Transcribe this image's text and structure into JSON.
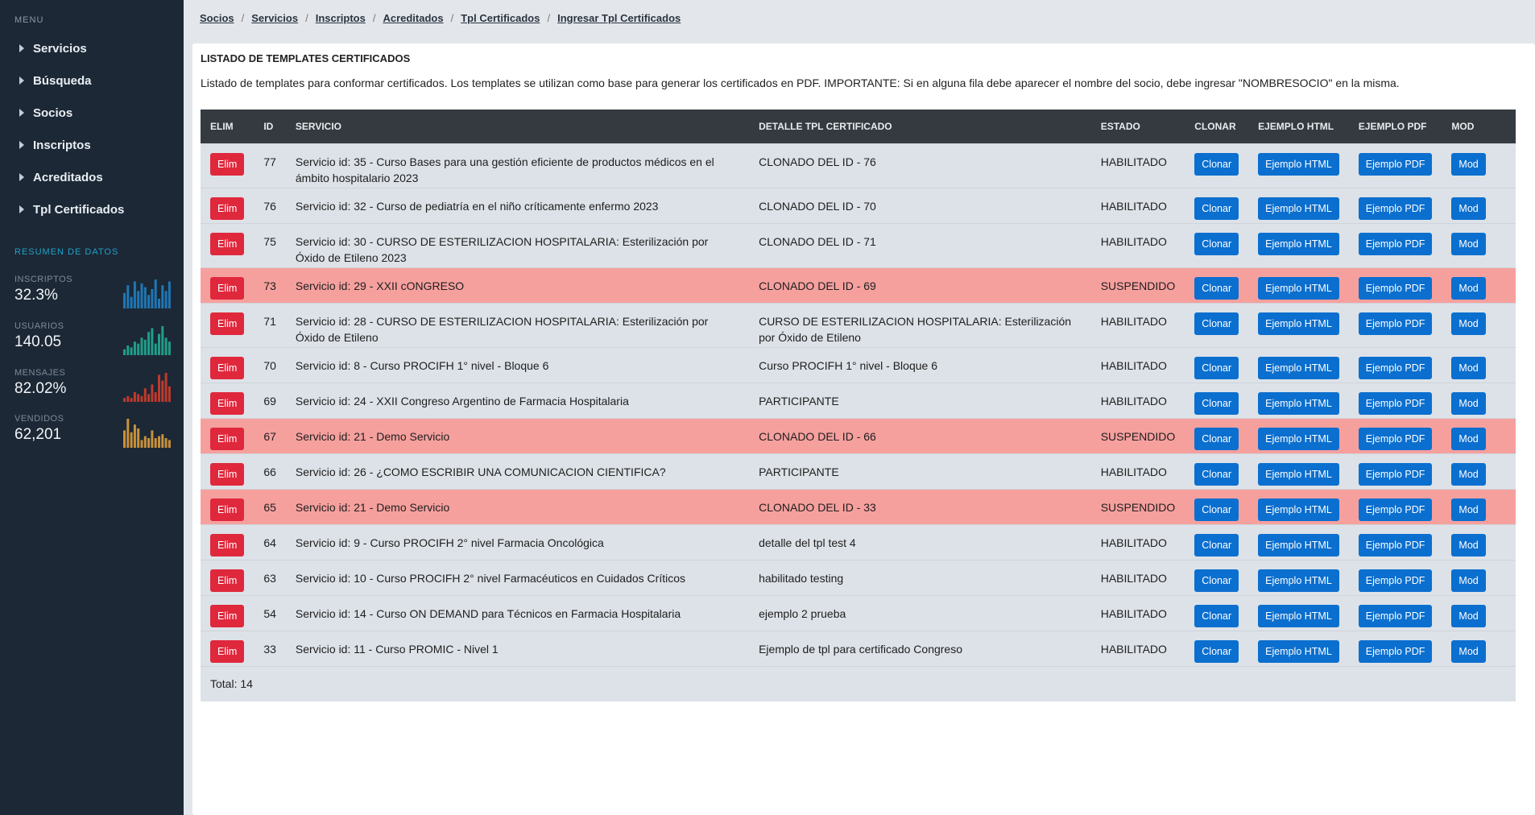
{
  "sidebar": {
    "menu_title": "MENU",
    "items": [
      {
        "label": "Servicios",
        "name": "sidebar-item-servicios"
      },
      {
        "label": "Búsqueda",
        "name": "sidebar-item-busqueda"
      },
      {
        "label": "Socios",
        "name": "sidebar-item-socios"
      },
      {
        "label": "Inscriptos",
        "name": "sidebar-item-inscriptos"
      },
      {
        "label": "Acreditados",
        "name": "sidebar-item-acreditados"
      },
      {
        "label": "Tpl Certificados",
        "name": "sidebar-item-tpl-certificados"
      }
    ],
    "resumen_title": "RESUMEN DE DATOS",
    "stats": [
      {
        "label": "INSCRIPTOS",
        "value": "32.3%",
        "color": "#1f77b4",
        "bars": [
          8,
          12,
          6,
          14,
          9,
          13,
          11,
          7,
          10,
          15,
          5,
          12,
          9,
          14
        ]
      },
      {
        "label": "USUARIOS",
        "value": "140.05",
        "color": "#1f9e89",
        "bars": [
          3,
          5,
          4,
          7,
          6,
          9,
          8,
          12,
          14,
          6,
          11,
          15,
          9,
          7
        ]
      },
      {
        "label": "MENSAJES",
        "value": "82.02%",
        "color": "#c0392b",
        "bars": [
          2,
          3,
          2,
          5,
          4,
          3,
          7,
          4,
          9,
          5,
          14,
          11,
          15,
          8
        ]
      },
      {
        "label": "VENDIDOS",
        "value": "62,201",
        "color": "#c8913b",
        "bars": [
          9,
          15,
          8,
          12,
          10,
          4,
          6,
          5,
          9,
          5,
          6,
          7,
          5,
          4
        ]
      }
    ]
  },
  "breadcrumb": [
    "Socios",
    "Servicios",
    "Inscriptos",
    "Acreditados",
    "Tpl Certificados",
    "Ingresar Tpl Certificados"
  ],
  "panel": {
    "title": "LISTADO DE TEMPLATES CERTIFICADOS",
    "description": "Listado de templates para conformar certificados. Los templates se utilizan como base para generar los certificados en PDF. IMPORTANTE: Si en alguna fila debe aparecer el nombre del socio, debe ingresar \"NOMBRESOCIO\" en la misma."
  },
  "table": {
    "headers": [
      "ELIM",
      "ID",
      "SERVICIO",
      "DETALLE TPL CERTIFICADO",
      "ESTADO",
      "CLONAR",
      "EJEMPLO HTML",
      "EJEMPLO PDF",
      "MOD"
    ],
    "buttons": {
      "elim": "Elim",
      "clonar": "Clonar",
      "html": "Ejemplo HTML",
      "pdf": "Ejemplo PDF",
      "mod": "Mod"
    },
    "status_colors": {
      "HABILITADO": "#dde2e8",
      "SUSPENDIDO": "#f6a09e"
    },
    "rows": [
      {
        "id": "77",
        "servicio": "Servicio id: 35 - Curso Bases para una gestión eficiente de productos médicos en el ámbito hospitalario 2023",
        "detalle": "CLONADO DEL ID - 76",
        "estado": "HABILITADO"
      },
      {
        "id": "76",
        "servicio": "Servicio id: 32 - Curso de pediatría en el niño críticamente enfermo 2023",
        "detalle": "CLONADO DEL ID - 70",
        "estado": "HABILITADO"
      },
      {
        "id": "75",
        "servicio": "Servicio id: 30 - CURSO DE ESTERILIZACION HOSPITALARIA: Esterilización por Óxido de Etileno 2023",
        "detalle": "CLONADO DEL ID - 71",
        "estado": "HABILITADO"
      },
      {
        "id": "73",
        "servicio": "Servicio id: 29 - XXII cONGRESO",
        "detalle": "CLONADO DEL ID - 69",
        "estado": "SUSPENDIDO"
      },
      {
        "id": "71",
        "servicio": "Servicio id: 28 - CURSO DE ESTERILIZACION HOSPITALARIA: Esterilización por Óxido de Etileno",
        "detalle": "CURSO DE ESTERILIZACION HOSPITALARIA: Esterilización por Óxido de Etileno",
        "estado": "HABILITADO"
      },
      {
        "id": "70",
        "servicio": "Servicio id: 8 - Curso PROCIFH 1° nivel - Bloque 6",
        "detalle": "Curso PROCIFH 1° nivel - Bloque 6",
        "estado": "HABILITADO"
      },
      {
        "id": "69",
        "servicio": "Servicio id: 24 - XXII Congreso Argentino de Farmacia Hospitalaria",
        "detalle": "PARTICIPANTE",
        "estado": "HABILITADO"
      },
      {
        "id": "67",
        "servicio": "Servicio id: 21 - Demo Servicio",
        "detalle": "CLONADO DEL ID - 66",
        "estado": "SUSPENDIDO"
      },
      {
        "id": "66",
        "servicio": "Servicio id: 26 - ¿COMO ESCRIBIR UNA COMUNICACION CIENTIFICA?",
        "detalle": "PARTICIPANTE",
        "estado": "HABILITADO"
      },
      {
        "id": "65",
        "servicio": "Servicio id: 21 - Demo Servicio",
        "detalle": "CLONADO DEL ID - 33",
        "estado": "SUSPENDIDO"
      },
      {
        "id": "64",
        "servicio": "Servicio id: 9 - Curso PROCIFH 2° nivel Farmacia Oncológica",
        "detalle": "detalle del tpl test 4",
        "estado": "HABILITADO"
      },
      {
        "id": "63",
        "servicio": "Servicio id: 10 - Curso PROCIFH 2° nivel Farmacéuticos en Cuidados Críticos",
        "detalle": "habilitado testing",
        "estado": "HABILITADO"
      },
      {
        "id": "54",
        "servicio": "Servicio id: 14 - Curso ON DEMAND para Técnicos en Farmacia Hospitalaria",
        "detalle": "ejemplo 2 prueba",
        "estado": "HABILITADO"
      },
      {
        "id": "33",
        "servicio": "Servicio id: 11 - Curso PROMIC - Nivel 1",
        "detalle": "Ejemplo de tpl para certificado Congreso",
        "estado": "HABILITADO"
      }
    ],
    "total": "Total: 14"
  }
}
